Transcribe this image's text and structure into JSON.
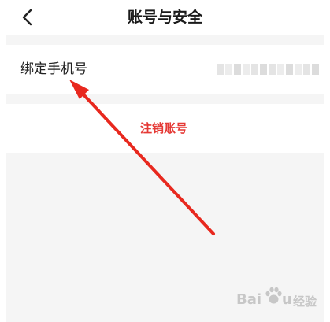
{
  "header": {
    "title": "账号与安全",
    "back_icon": "chevron-left-icon"
  },
  "account": {
    "bind_phone_label": "绑定手机号",
    "bind_phone_value": "(blurred)",
    "deregister_label": "注销账号"
  },
  "annotation": {
    "arrow_color": "#e8281e"
  },
  "watermark": {
    "text_latin_1": "Bai",
    "text_latin_2": "u",
    "text_cn": "经验"
  },
  "colors": {
    "deregister": "#e53935",
    "background": "#f5f5f5"
  }
}
